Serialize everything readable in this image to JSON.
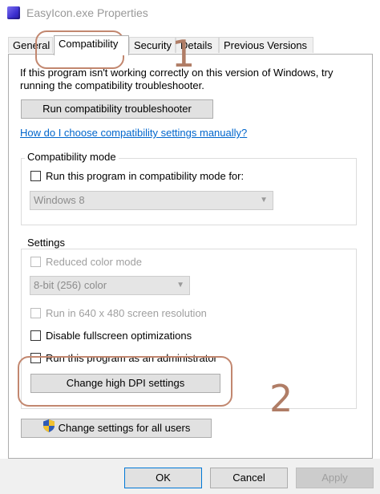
{
  "window": {
    "title": "EasyIcon.exe Properties"
  },
  "tabs": [
    {
      "label": "General"
    },
    {
      "label": "Compatibility"
    },
    {
      "label": "Security"
    },
    {
      "label": "Details"
    },
    {
      "label": "Previous Versions"
    }
  ],
  "intro_text": "If this program isn't working correctly on this version of Windows, try running the compatibility troubleshooter.",
  "troubleshooter_button": "Run compatibility troubleshooter",
  "help_link": "How do I choose compatibility settings manually?",
  "compat_mode": {
    "group_title": "Compatibility mode",
    "checkbox_label": "Run this program in compatibility mode for:",
    "checked": false,
    "select_value": "Windows 8",
    "enabled": false
  },
  "settings": {
    "group_title": "Settings",
    "reduced_color_label": "Reduced color mode",
    "reduced_color_enabled": false,
    "color_select_value": "8-bit (256) color",
    "resolution_label": "Run in 640 x 480 screen resolution",
    "resolution_enabled": false,
    "fullscreen_label": "Disable fullscreen optimizations",
    "fullscreen_checked": false,
    "admin_label": "Run this program as an administrator",
    "admin_checked": false,
    "dpi_button": "Change high DPI settings"
  },
  "all_users_button": "Change settings for all users",
  "dialog_buttons": {
    "ok": "OK",
    "cancel": "Cancel",
    "apply": "Apply"
  },
  "annotations": {
    "first": "1",
    "second": "2",
    "color": "#c2876f"
  },
  "colors": {
    "link": "#0066cc",
    "icon_brand": "#3b2fd0",
    "button_face": "#e1e1e1"
  }
}
